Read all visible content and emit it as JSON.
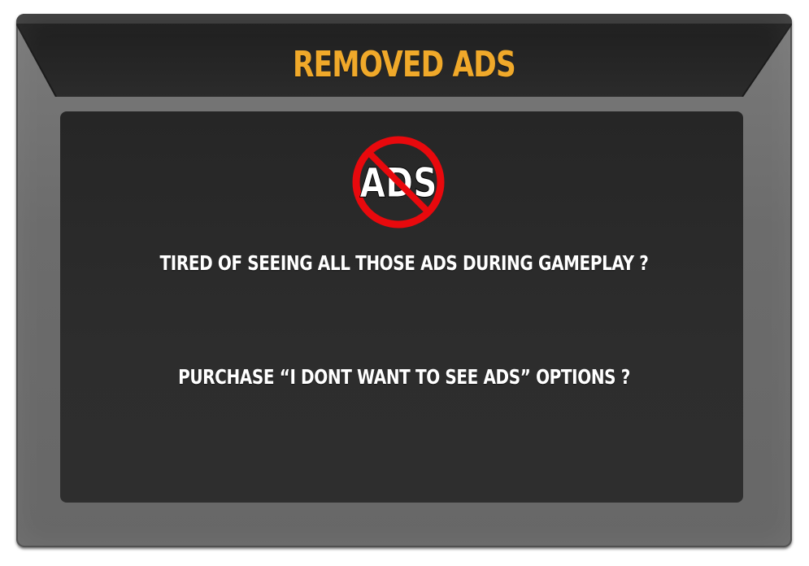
{
  "dialog": {
    "title": "REMOVED ADS",
    "icon": {
      "name": "no-ads-icon",
      "text": "ADS"
    },
    "message_question": "TIRED OF SEEING ALL THOSE ADS DURING GAMEPLAY ?",
    "message_offer": "PURCHASE “I DONT WANT TO SEE ADS” OPTIONS ?"
  },
  "colors": {
    "title": "#f0a92a",
    "frame": "#6c6c6c",
    "panel": "#2a2a2a",
    "header": "#262626",
    "prohibit_red": "#e8090d",
    "text": "#ffffff"
  }
}
